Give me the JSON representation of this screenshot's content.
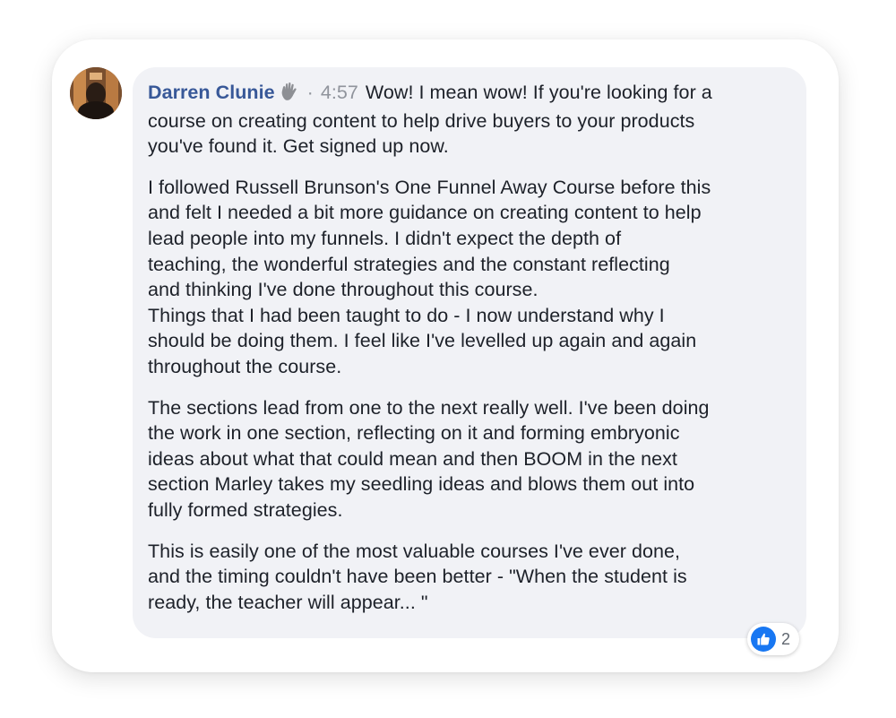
{
  "comment": {
    "author": "Darren Clunie",
    "author_badge_icon": "wave-hand-icon",
    "separator": "·",
    "time": "4:57",
    "first_text": "Wow! I mean wow! If you're looking for a",
    "paragraph1_lines": [
      "course on creating content to help drive buyers to your products",
      "you've found it. Get signed up now."
    ],
    "paragraph2_lines": [
      "I followed Russell Brunson's One Funnel Away Course before this",
      "and felt I needed a bit more guidance on creating content to help",
      "lead people into my funnels. I didn't expect the depth of",
      "teaching, the wonderful strategies and the constant reflecting",
      "and thinking I've done throughout this course.",
      "Things that I had been taught to do - I now understand why I",
      "should be doing them. I feel like I've levelled up again and again",
      "throughout the course."
    ],
    "paragraph3_lines": [
      "The sections lead from one to the next really well. I've been doing",
      "the work in one section, reflecting on it and forming embryonic",
      "ideas about what that could mean and then BOOM in the next",
      "section Marley takes my seedling ideas and blows them out into",
      "fully formed strategies."
    ],
    "paragraph4_lines": [
      "This is easily one of the most valuable courses I've ever done,",
      "and the timing couldn't have been better - \"When the student is",
      "ready, the teacher will appear... \""
    ]
  },
  "reactions": {
    "icon": "like-thumb-icon",
    "count": "2"
  },
  "colors": {
    "author": "#385898",
    "bubble": "#f1f2f6",
    "like": "#1877f2",
    "meta": "#90949c"
  }
}
